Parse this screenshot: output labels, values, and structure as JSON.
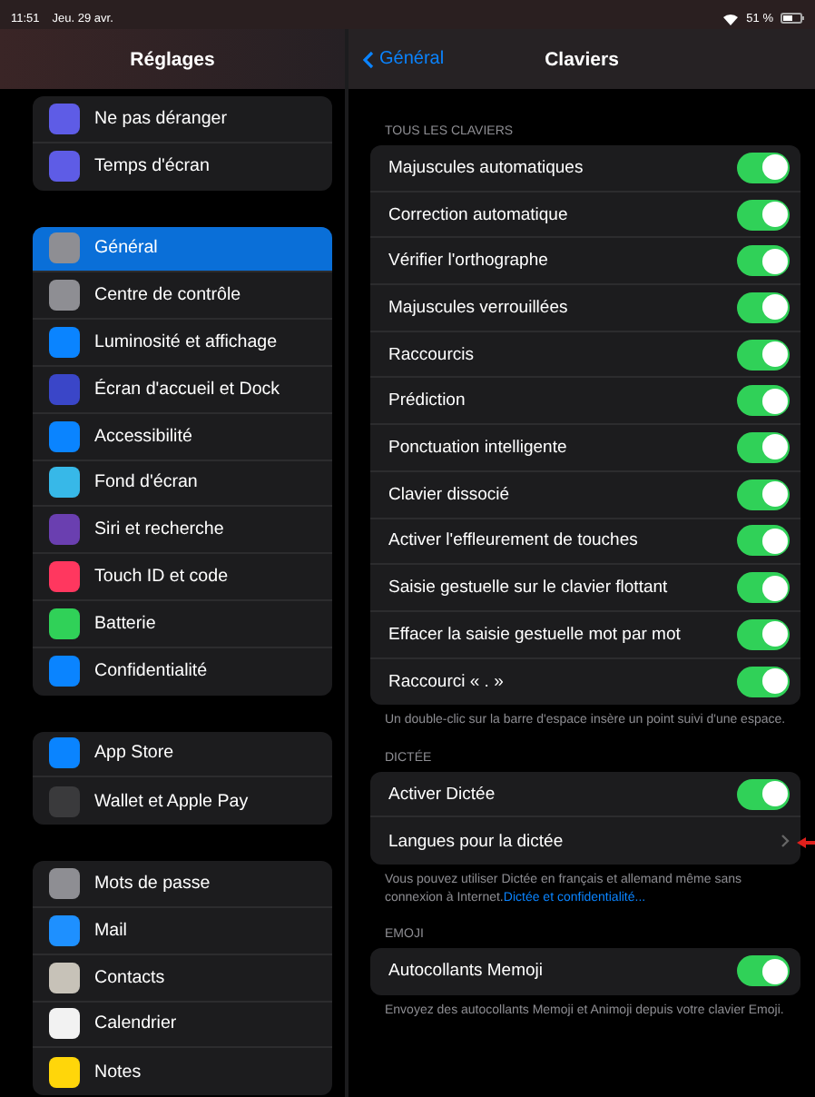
{
  "status_bar": {
    "time": "11:51",
    "date": "Jeu. 29 avr.",
    "battery": "51 %"
  },
  "sidebar": {
    "title": "Réglages",
    "groups": [
      {
        "items": [
          {
            "label": "Ne pas déranger",
            "color": "#5e5ce6",
            "selected": false
          },
          {
            "label": "Temps d'écran",
            "color": "#5e5ce6",
            "selected": false
          }
        ]
      },
      {
        "items": [
          {
            "label": "Général",
            "color": "#8e8e93",
            "selected": true
          },
          {
            "label": "Centre de contrôle",
            "color": "#8e8e93",
            "selected": false
          },
          {
            "label": "Luminosité et affichage",
            "color": "#0a84ff",
            "selected": false
          },
          {
            "label": "Écran d'accueil et Dock",
            "color": "#3a46c8",
            "selected": false
          },
          {
            "label": "Accessibilité",
            "color": "#0a84ff",
            "selected": false
          },
          {
            "label": "Fond d'écran",
            "color": "#37b8e8",
            "selected": false
          },
          {
            "label": "Siri et recherche",
            "color": "#6a3fb0",
            "selected": false
          },
          {
            "label": "Touch ID et code",
            "color": "#ff375f",
            "selected": false
          },
          {
            "label": "Batterie",
            "color": "#30d158",
            "selected": false
          },
          {
            "label": "Confidentialité",
            "color": "#0a84ff",
            "selected": false
          }
        ]
      },
      {
        "items": [
          {
            "label": "App Store",
            "color": "#0a84ff",
            "selected": false
          },
          {
            "label": "Wallet et Apple Pay",
            "color": "#3a3a3c",
            "selected": false
          }
        ]
      },
      {
        "items": [
          {
            "label": "Mots de passe",
            "color": "#8e8e93",
            "selected": false
          },
          {
            "label": "Mail",
            "color": "#1e90ff",
            "selected": false
          },
          {
            "label": "Contacts",
            "color": "#c7c2b8",
            "selected": false
          },
          {
            "label": "Calendrier",
            "color": "#f2f2f2",
            "selected": false
          },
          {
            "label": "Notes",
            "color": "#ffd60a",
            "selected": false
          }
        ]
      }
    ]
  },
  "detail": {
    "back": "Général",
    "title": "Claviers",
    "sections": [
      {
        "header": "TOUS LES CLAVIERS",
        "rows": [
          {
            "kind": "toggle",
            "label": "Majuscules automatiques",
            "on": true
          },
          {
            "kind": "toggle",
            "label": "Correction automatique",
            "on": true
          },
          {
            "kind": "toggle",
            "label": "Vérifier l'orthographe",
            "on": true
          },
          {
            "kind": "toggle",
            "label": "Majuscules verrouillées",
            "on": true
          },
          {
            "kind": "toggle",
            "label": "Raccourcis",
            "on": true
          },
          {
            "kind": "toggle",
            "label": "Prédiction",
            "on": true
          },
          {
            "kind": "toggle",
            "label": "Ponctuation intelligente",
            "on": true
          },
          {
            "kind": "toggle",
            "label": "Clavier dissocié",
            "on": true
          },
          {
            "kind": "toggle",
            "label": "Activer l'effleurement de touches",
            "on": true
          },
          {
            "kind": "toggle",
            "label": "Saisie gestuelle sur le clavier flottant",
            "on": true
          },
          {
            "kind": "toggle",
            "label": "Effacer la saisie gestuelle mot par mot",
            "on": true
          },
          {
            "kind": "toggle",
            "label": "Raccourci « . »",
            "on": true
          }
        ],
        "footer": "Un double-clic sur la barre d'espace insère un point suivi d'une espace."
      },
      {
        "header": "DICTÉE",
        "rows": [
          {
            "kind": "toggle",
            "label": "Activer Dictée",
            "on": true
          },
          {
            "kind": "link",
            "label": "Langues pour la dictée"
          }
        ],
        "footer": "Vous pouvez utiliser Dictée en français et allemand même sans connexion à Internet.",
        "footer_link": "Dictée et confidentialité..."
      },
      {
        "header": "EMOJI",
        "rows": [
          {
            "kind": "toggle",
            "label": "Autocollants Memoji",
            "on": true
          }
        ],
        "footer": "Envoyez des autocollants Memoji et Animoji depuis votre clavier Emoji."
      }
    ]
  }
}
